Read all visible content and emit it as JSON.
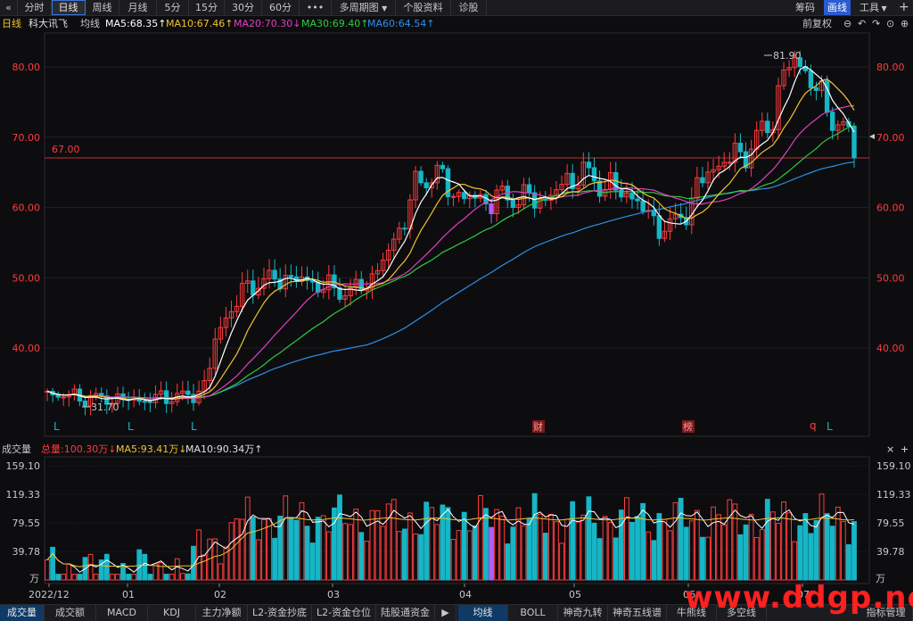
{
  "toolbar": {
    "back_icon": "«",
    "items": [
      "分时",
      "日线",
      "周线",
      "月线",
      "5分",
      "15分",
      "30分",
      "60分",
      "•••",
      "多周期图",
      "个股资料",
      "诊股"
    ],
    "active": "日线",
    "right": [
      "筹码",
      "画线",
      "工具"
    ],
    "plus_icon": "+",
    "close_icon": "×"
  },
  "legend": {
    "period": "日线",
    "name": "科大讯飞",
    "avg": "均线",
    "ma5": "MA5:68.35↑",
    "ma10": "MA10:67.46↑",
    "ma20": "MA20:70.30↓",
    "ma30": "MA30:69.40↑",
    "ma60": "MA60:64.54↑",
    "fuquan": "前复权",
    "colors": {
      "ma5": "#ffffff",
      "ma10": "#f2c230",
      "ma20": "#e040c0",
      "ma30": "#2ecc40",
      "ma60": "#2f8fe8",
      "up": "#ff3b3b",
      "down": "#16b6c6"
    }
  },
  "price_axis": {
    "ticks": [
      "80.00",
      "70.00",
      "60.00",
      "50.00",
      "40.00"
    ],
    "ref_line": "67.00",
    "high_label": "81.90",
    "low_label": "31.70",
    "marker_L": "L",
    "marker_cai": "财",
    "marker_bang": "榜",
    "marker_q": "q"
  },
  "volume": {
    "title": "成交量",
    "total": "总量:100.30万↓",
    "ma5": "MA5:93.41万↓",
    "ma10": "MA10:90.34万↑",
    "ticks": [
      "159.10",
      "119.33",
      "79.55",
      "39.78"
    ],
    "unit": "万",
    "close_icon": "×",
    "plus_icon": "+"
  },
  "x_axis": [
    "2022/12",
    "01",
    "02",
    "03",
    "04",
    "05",
    "06",
    "07"
  ],
  "tabs": {
    "left": [
      "成交量",
      "成交额",
      "MACD",
      "KDJ",
      "主力净额",
      "L2-资金抄底",
      "L2-资金仓位",
      "陆股通资金"
    ],
    "right": [
      "均线",
      "BOLL",
      "神奇九转",
      "神奇五线谱",
      "牛熊线",
      "多空线"
    ],
    "manage": "指标管理",
    "active_left": "成交量",
    "active_right": "均线"
  },
  "watermark": "www.ddgp.net"
}
